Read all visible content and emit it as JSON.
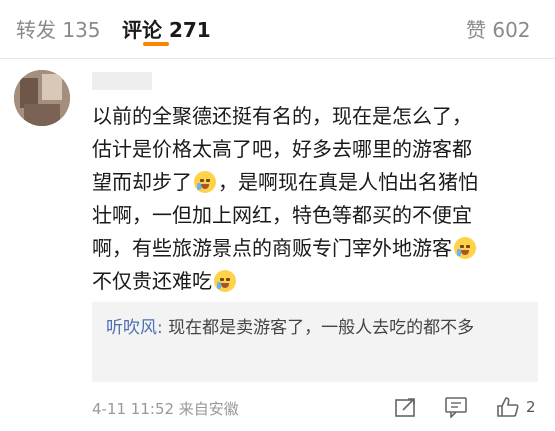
{
  "tabs": {
    "repost": "转发 135",
    "comment": "评论 271",
    "like": "赞 602"
  },
  "colors": {
    "accent": "#ff8200",
    "reply_user": "#4e6fb3"
  },
  "comment": {
    "line1": "以前的全聚德还挺有名的，现在是怎么了，",
    "line2": "估计是价格太高了吧，好多去哪里的游客都",
    "line3a": "望而却步了",
    "line3b": "，是啊现在真是人怕出名猪怕",
    "line4": "壮啊，一但加上网红，特色等都买的不便宜",
    "line5": "啊，有些旅游景点的商贩专门宰外地游客",
    "line6": "不仅贵还难吃"
  },
  "reply": {
    "user": "听吹风:",
    "text": " 现在都是卖游客了，一般人去吃的都不多"
  },
  "meta": {
    "time_source": "4-11 11:52 来自安徽",
    "like_count": "2"
  },
  "icons": [
    "laugh-cry-emoji-icon",
    "cry-emoji-icon",
    "share-icon",
    "comment-icon",
    "like-icon"
  ]
}
